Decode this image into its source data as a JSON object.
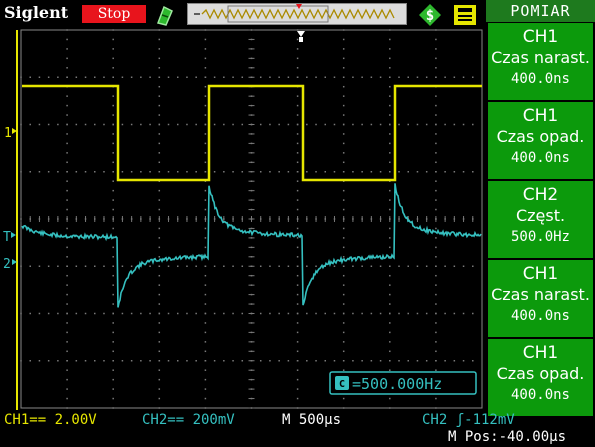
{
  "brand": "Siglent",
  "run_state": "Stop",
  "menu": {
    "title": "POMIAR",
    "items": [
      {
        "source": "CH1",
        "measurement": "Czas narast.",
        "value": "400.0ns"
      },
      {
        "source": "CH1",
        "measurement": "Czas opad.",
        "value": "400.0ns"
      },
      {
        "source": "CH2",
        "measurement": "Częst.",
        "value": "500.0Hz"
      },
      {
        "source": "CH1",
        "measurement": "Czas narast.",
        "value": "400.0ns"
      },
      {
        "source": "CH1",
        "measurement": "Czas opad.",
        "value": "400.0ns"
      }
    ]
  },
  "frequency_counter": "=500.000Hz",
  "status": {
    "ch1": "CH1== 2.00V",
    "ch2": "CH2== 200mV",
    "timebase": "M 500µs",
    "trigger": "CH2 ʃ-112mV",
    "position": "M Pos:-40.00µs"
  },
  "channel_markers": {
    "ch1": "1",
    "ch2": "2",
    "trigger": "T"
  },
  "colors": {
    "ch1": "#e6e600",
    "ch2": "#35c0c0",
    "grid": "#7a7a7a",
    "menu": "#0c9a0c",
    "menu_title": "#1e7a1e",
    "stop": "#e8141c"
  },
  "icons": [
    "trigger-icon",
    "utility-icon",
    "save-icon",
    "trigger-position-arrow"
  ]
}
